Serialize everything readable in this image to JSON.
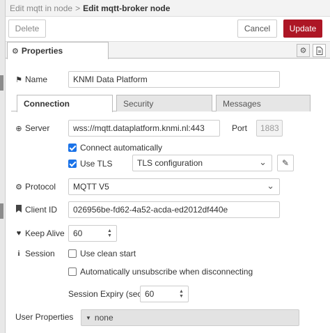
{
  "breadcrumb": {
    "parent": "Edit mqtt in node",
    "separator": ">",
    "current": "Edit mqtt-broker node"
  },
  "toolbar": {
    "delete_label": "Delete",
    "cancel_label": "Cancel",
    "update_label": "Update"
  },
  "tabs": {
    "properties_label": "Properties"
  },
  "name": {
    "label": "Name",
    "value": "KNMI Data Platform"
  },
  "subtabs": [
    "Connection",
    "Security",
    "Messages"
  ],
  "server": {
    "label": "Server",
    "value": "wss://mqtt.dataplatform.knmi.nl:443",
    "port_label": "Port",
    "port_placeholder": "1883"
  },
  "connect_auto": {
    "label": "Connect automatically",
    "checked": true
  },
  "tls": {
    "label": "Use TLS",
    "checked": true,
    "config_value": "TLS configuration"
  },
  "protocol": {
    "label": "Protocol",
    "value": "MQTT V5"
  },
  "client_id": {
    "label": "Client ID",
    "value": "026956be-fd62-4a52-acda-ed2012df440e"
  },
  "keep_alive": {
    "label": "Keep Alive",
    "value": "60"
  },
  "session": {
    "label": "Session",
    "clean_start_label": "Use clean start",
    "auto_unsub_label": "Automatically unsubscribe when disconnecting",
    "expiry_label": "Session Expiry (secs)",
    "expiry_value": "60"
  },
  "user_properties": {
    "label": "User Properties",
    "value": "none"
  },
  "colors": {
    "accent": "#ad1625",
    "checkbox": "#1b73e8"
  },
  "icons": {
    "properties": "gear-icon",
    "name": "tag-icon",
    "server": "globe-icon",
    "protocol": "cog-icon",
    "client_id": "bookmark-icon",
    "keep_alive": "heartbeat-icon",
    "session": "info-icon"
  }
}
